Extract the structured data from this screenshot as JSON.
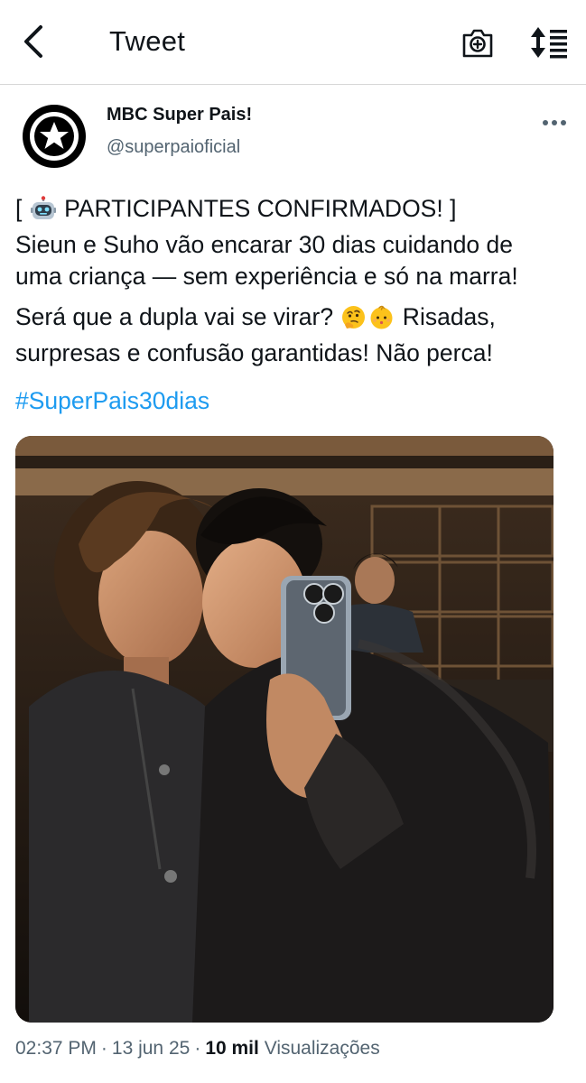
{
  "header": {
    "title": "Tweet"
  },
  "author": {
    "name": "MBC Super Pais!",
    "handle": "@superpaioficial"
  },
  "tweet": {
    "line1_prefix": "[ ",
    "line1_suffix": " PARTICIPANTES CONFIRMADOS! ]",
    "line2": "Sieun e Suho vão encarar 30 dias cuidando de",
    "line3": "uma criança — sem experiência e só na marra!",
    "line4_prefix": "Será que a dupla vai se virar? ",
    "line4_suffix": " Risadas,",
    "line5": "surpresas e confusão garantidas! Não perca!",
    "hashtag": "#SuperPais30dias"
  },
  "meta": {
    "time": "02:37 PM",
    "date": "13 jun 25",
    "views_count": "10 mil",
    "views_label": "Visualizações",
    "separator": "·"
  },
  "icons": {
    "back": "chevron-left-icon",
    "camera": "camera-plus-icon",
    "sort": "sort-list-icon",
    "more": "more-horizontal-icon",
    "robot_emoji": "robot-emoji",
    "thinking_emoji": "thinking-face-emoji",
    "baby_emoji": "baby-emoji"
  },
  "colors": {
    "link": "#1d9bf0",
    "secondary_text": "#536471",
    "primary_text": "#0f1419"
  }
}
